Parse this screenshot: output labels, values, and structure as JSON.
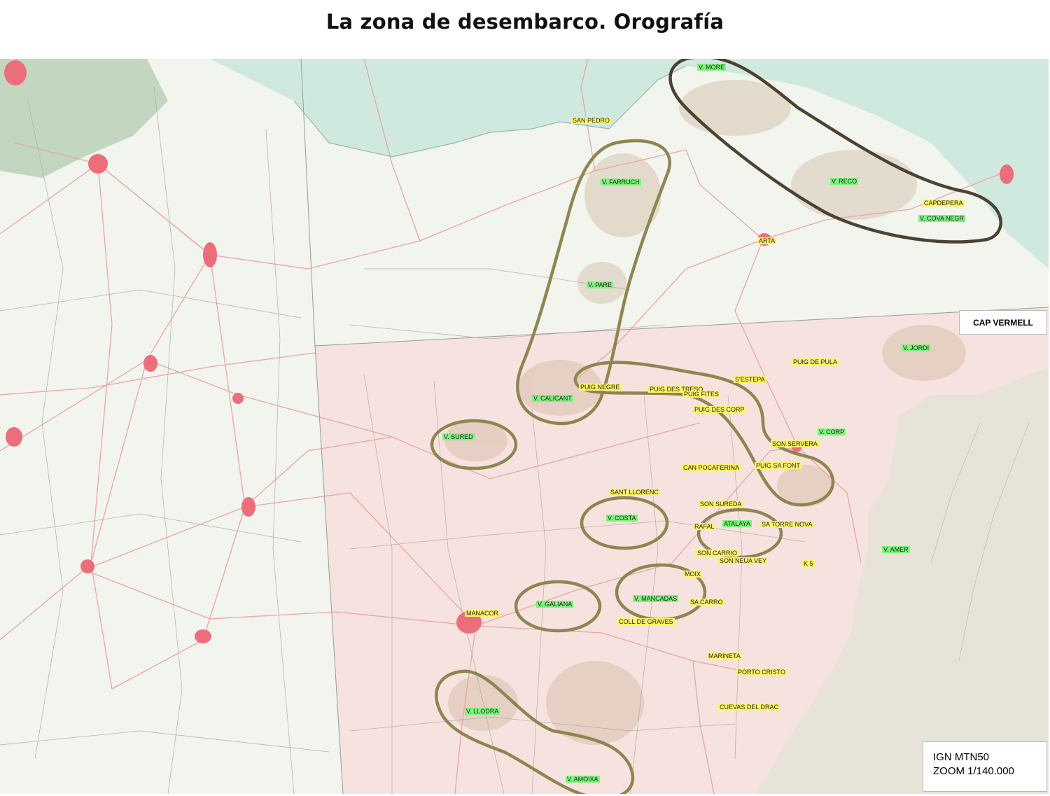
{
  "title": "La zona de desembarco. Orografía",
  "boxes": {
    "cap": "CAP VERMELL",
    "source_line1": "IGN MTN50",
    "source_line2": "ZOOM 1/140.000"
  },
  "peak_labels": [
    "V. MORE",
    "V. FARRUCH",
    "V. PARE",
    "V. RECO",
    "V. COVA NEGR",
    "V. JORDI",
    "V. CALICANT",
    "V. SURED",
    "V. CORP",
    "V. COSTA",
    "ATALAYA",
    "V. AMER",
    "V. GALIANA",
    "V. MANCADAS",
    "V. LLODRA",
    "V. AMOIXA"
  ],
  "place_labels": [
    "SAN PEDRO",
    "CAPDEPERA",
    "ARTA",
    "PUIG DE PULA",
    "S'ESTEPA",
    "PUIG NEGRE",
    "PUIG DES TRESO",
    "PUIG FITES",
    "PUIG DES CORP",
    "SON SERVERA",
    "PUIG SA FONT",
    "CAN POCAFERINA",
    "SANT LLORENC",
    "SON SUREDA",
    "RAFAL",
    "SA TORRE NOVA",
    "SON CARRIO",
    "SON NEUA VEY",
    "K 5",
    "MOIX",
    "SA CARRO",
    "MANACOR",
    "COLL DE GRAVES",
    "MARINETA",
    "PORTO CRISTO",
    "CUEVAS DEL DRAC"
  ],
  "colors": {
    "land": "#f2f4ee",
    "sheet_pink": "#f6e3df",
    "sea_north": "#cfe9df",
    "sea_east": "#e8e3d9",
    "roads": "#e9a5a5",
    "towns": "#ec6e7a",
    "ellipse_olive": "#8d8652",
    "ellipse_dark": "#4b4230",
    "peak_label_bg": "#7cf57a",
    "place_label_bg": "#fff36a"
  }
}
